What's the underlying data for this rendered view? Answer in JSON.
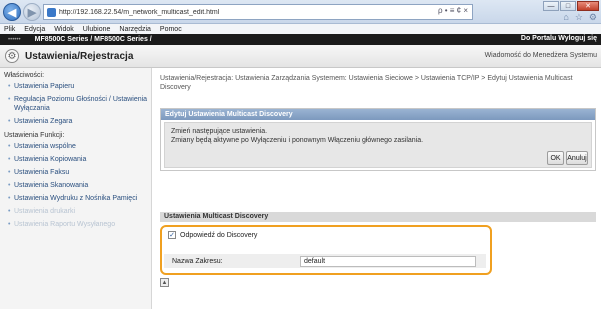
{
  "browser": {
    "url": "http://192.168.22.54/m_network_multicast_edit.html",
    "url_tools": "ρ • ≡ ¢ ×",
    "menu": [
      "Plik",
      "Edycja",
      "Widok",
      "Ulubione",
      "Narzędzia",
      "Pomoc"
    ]
  },
  "device_bar": {
    "model": "••••••",
    "series": "MF8500C Series / MF8500C Series /",
    "right": "Do Portalu  Wyloguj się"
  },
  "header": {
    "title": "Ustawienia/Rejestracja",
    "admin_msg": "Wiadomość do Menedżera Systemu"
  },
  "sidebar": {
    "sections": [
      {
        "title": "Właściwości:",
        "items": [
          "Ustawienia Papieru",
          "Regulacja Poziomu Głośności / Ustawienia Wyłączania",
          "Ustawienia Zegara"
        ]
      },
      {
        "title": "Ustawienia Funkcji:",
        "items": [
          "Ustawienia wspólne",
          "Ustawienia Kopiowania",
          "Ustawienia Faksu",
          "Ustawienia Skanowania",
          "Ustawienia Wydruku z Nośnika Pamięci",
          "Ustawienia drukarki",
          "Ustawienia Raportu Wysyłanego"
        ]
      }
    ]
  },
  "main": {
    "breadcrumb": "Ustawienia/Rejestracja: Ustawienia Zarządzania Systemem: Ustawienia Sieciowe > Ustawienia TCP/IP > Edytuj Ustawienia Multicast Discovery",
    "edit_panel": {
      "title": "Edytuj Ustawienia Multicast Discovery",
      "line1": "Zmień następujące ustawienia.",
      "line2": "Zmiany będą aktywne po Wyłączeniu i ponownym Włączeniu głównego zasilania.",
      "ok": "OK",
      "cancel": "Anuluj"
    },
    "settings": {
      "title": "Ustawienia Multicast Discovery",
      "respond_label": "Odpowiedź do Discovery",
      "respond_checked": true,
      "scope_label": "Nazwa Zakresu:",
      "scope_value": "default"
    }
  }
}
